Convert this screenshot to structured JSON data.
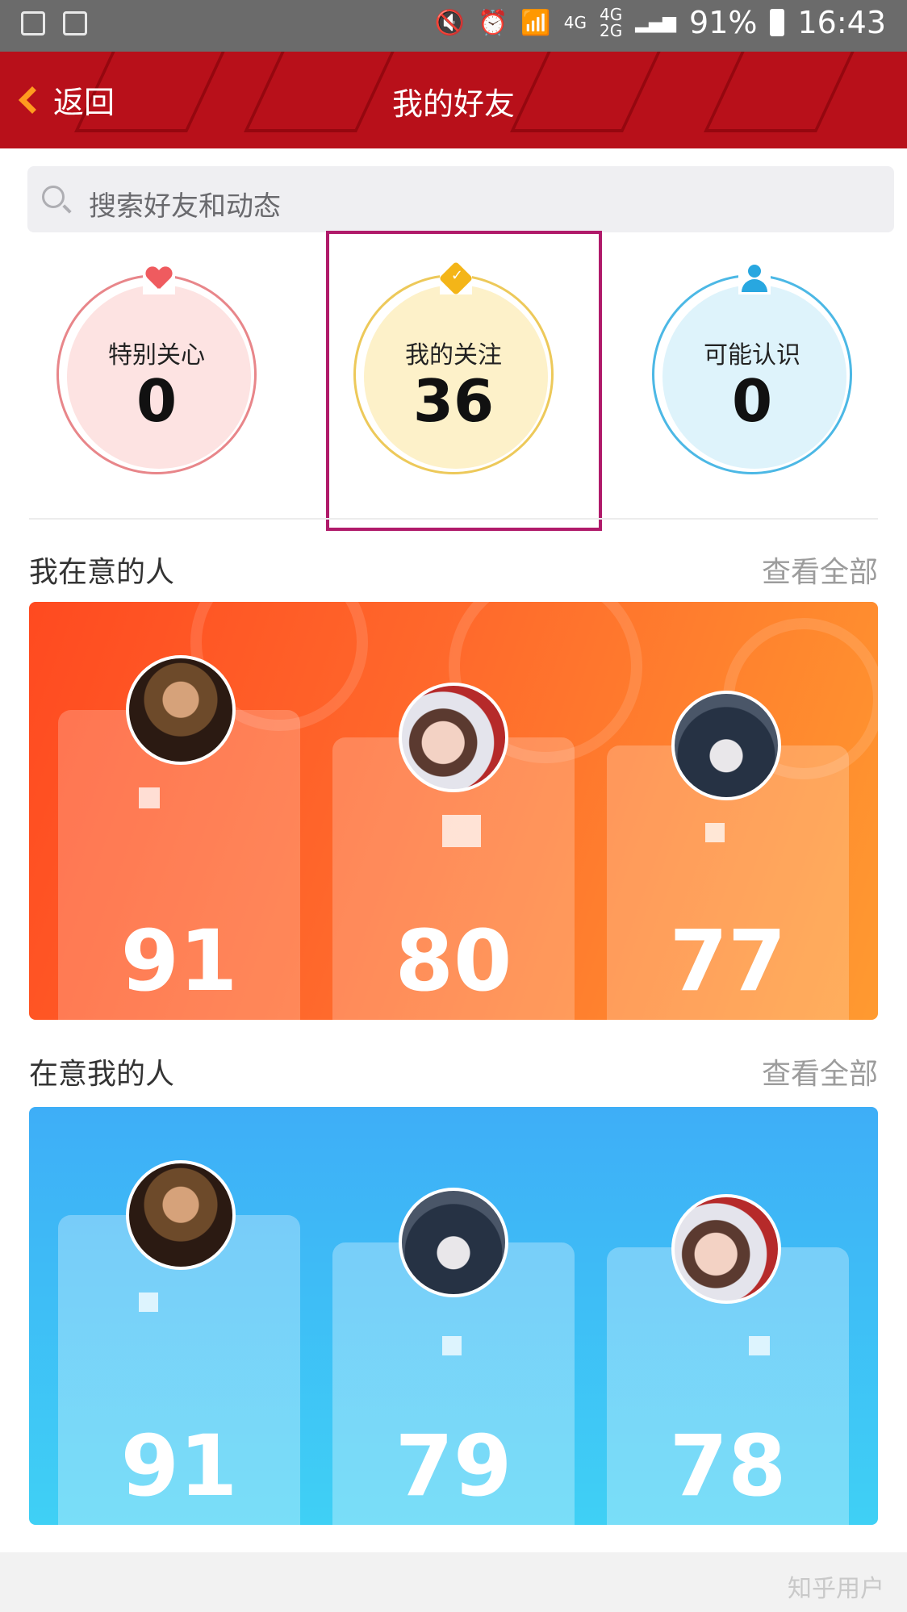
{
  "status_bar": {
    "network": "4G",
    "network2": "4G",
    "network3": "2G",
    "battery": "91%",
    "time": "16:43"
  },
  "header": {
    "back_label": "返回",
    "title": "我的好友"
  },
  "search": {
    "placeholder": "搜索好友和动态"
  },
  "stats": [
    {
      "label": "特别关心",
      "value": "0",
      "icon": "heart-icon",
      "color": "#ef5b5f"
    },
    {
      "label": "我的关注",
      "value": "36",
      "icon": "verified-badge-icon",
      "color": "#f4b518"
    },
    {
      "label": "可能认识",
      "value": "0",
      "icon": "person-icon",
      "color": "#28a7e0"
    }
  ],
  "section_i_care": {
    "title": "我在意的人",
    "view_all": "查看全部",
    "cards": [
      {
        "score": "91"
      },
      {
        "score": "80"
      },
      {
        "score": "77"
      }
    ]
  },
  "section_care_me": {
    "title": "在意我的人",
    "view_all": "查看全部",
    "cards": [
      {
        "score": "91"
      },
      {
        "score": "79"
      },
      {
        "score": "78"
      }
    ]
  },
  "watermark": "知乎用户"
}
